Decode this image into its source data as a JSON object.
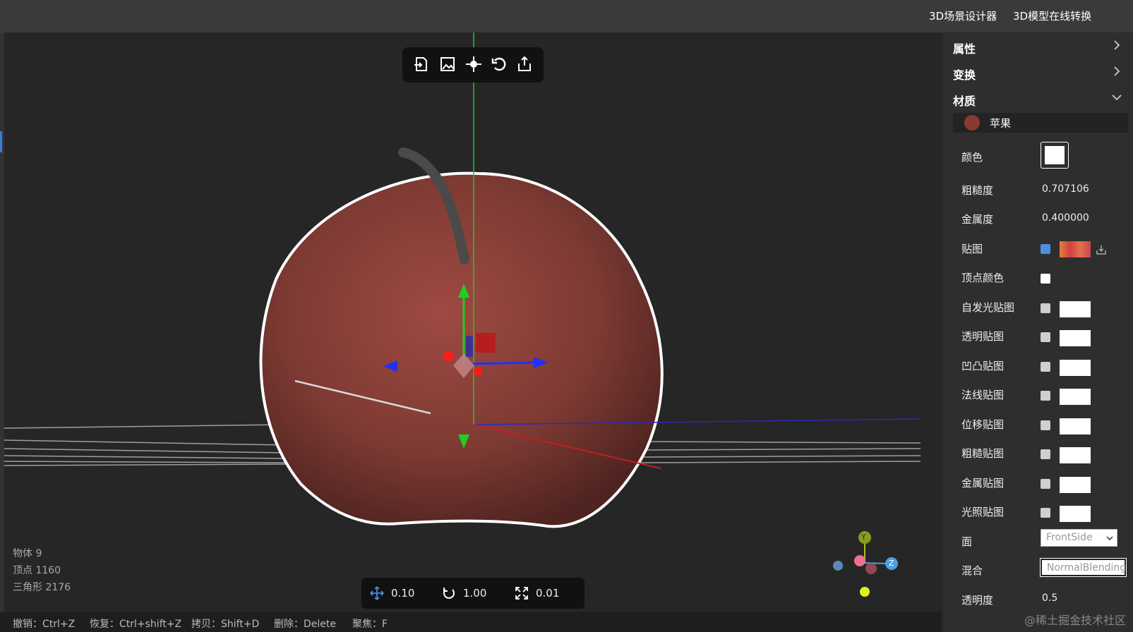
{
  "topbar": {
    "links": [
      "3D场景设计器",
      "3D模型在线转换"
    ]
  },
  "toolbar": {
    "icons": [
      "import-icon",
      "image-import-icon",
      "locate-icon",
      "reset-icon",
      "export-icon"
    ]
  },
  "stats": {
    "objects": "物体 9",
    "vertices": "顶点 1160",
    "triangles": "三角形 2176"
  },
  "snap": {
    "translate": "0.10",
    "rotate": "1.00",
    "scale": "0.01"
  },
  "status": [
    "撤销：Ctrl+Z",
    "恢复：Ctrl+shift+Z",
    "拷贝：Shift+D",
    "删除：Delete",
    "聚焦：F"
  ],
  "panel": {
    "sections": [
      "属性",
      "变换",
      "材质"
    ],
    "material_name": "苹果",
    "labels": {
      "color": "颜色",
      "roughness": "粗糙度",
      "metalness": "金属度",
      "map": "贴图",
      "vertex_colors": "顶点颜色",
      "emissive_map": "自发光贴图",
      "alpha_map": "透明贴图",
      "bump_map": "凹凸贴图",
      "normal_map": "法线贴图",
      "displacement_map": "位移贴图",
      "roughness_map": "粗糙贴图",
      "metalness_map": "金属贴图",
      "light_map": "光照贴图",
      "side": "面",
      "blending": "混合",
      "opacity": "透明度"
    },
    "values": {
      "roughness": "0.707106",
      "metalness": "0.400000",
      "side": "FrontSide",
      "blending": "NormalBlending",
      "opacity": "0.5"
    }
  },
  "gizmo": {
    "y": "Y",
    "z": "Z"
  },
  "watermark": "@稀土掘金技术社区",
  "colors": {
    "accent": "#4a90e2",
    "apple": "#8a3a33",
    "axis_x": "#e02020",
    "axis_y": "#20c020",
    "axis_z": "#2020e0"
  }
}
